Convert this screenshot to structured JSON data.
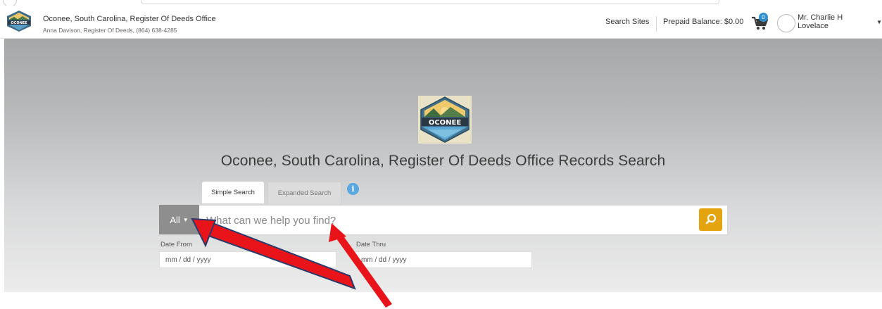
{
  "header": {
    "office_name": "Oconee, South Carolina, Register Of Deeds Office",
    "office_sub": "Anna Davison, Register Of Deeds, (864) 638-4285",
    "search_sites": "Search Sites",
    "prepaid_balance": "Prepaid Balance: $0.00",
    "cart_count": "0",
    "user_name": "Mr. Charlie H Lovelace",
    "logo_text": "OCONEE"
  },
  "hero": {
    "logo_text": "OCONEE",
    "title": "Oconee, South Carolina, Register Of Deeds Office Records Search"
  },
  "tabs": {
    "simple": "Simple Search",
    "expanded": "Expanded Search",
    "info_icon": "i"
  },
  "search": {
    "scope_label": "All",
    "placeholder": "What can we help you find?",
    "button_icon": "search-icon"
  },
  "dates": {
    "from_label": "Date From",
    "thru_label": "Date Thru",
    "from_placeholder": "mm / dd / yyyy",
    "thru_placeholder": "mm / dd / yyyy"
  },
  "colors": {
    "accent": "#e3a40f",
    "scope_button": "#8e8e8e",
    "info": "#5aa8e2",
    "badge": "#2f8fd0",
    "annotation_arrow": "#e8141a"
  }
}
